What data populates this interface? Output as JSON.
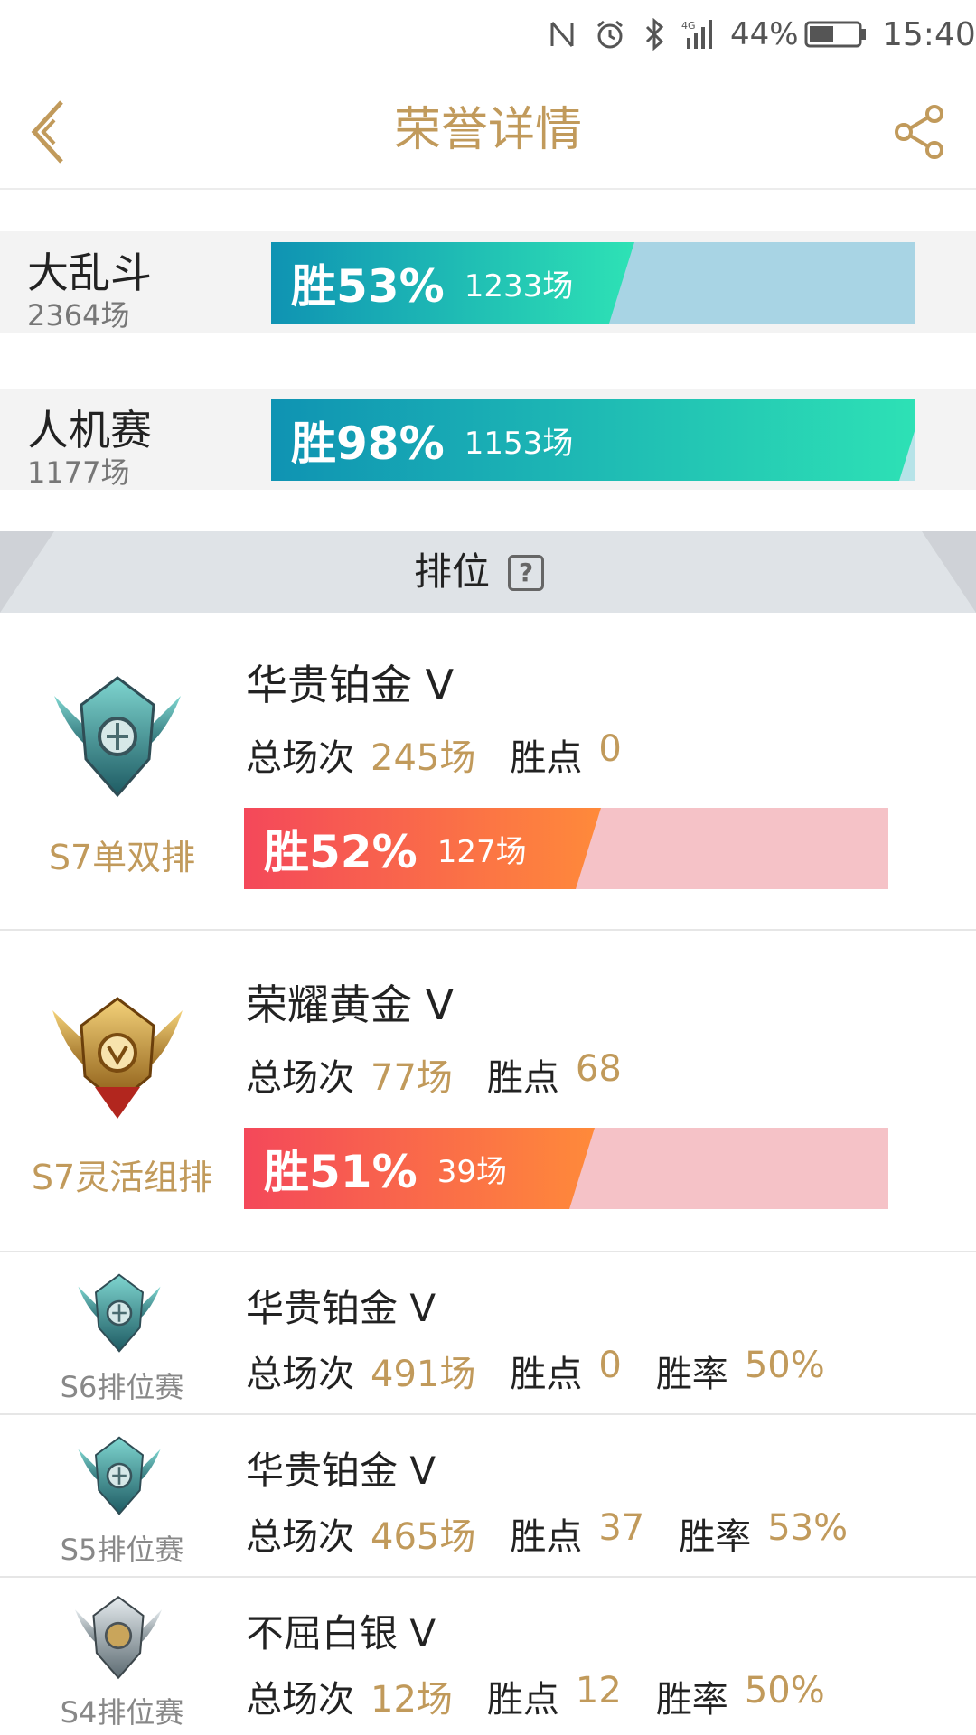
{
  "status_bar": {
    "battery_pct": "44%",
    "time": "15:40",
    "network": "4G",
    "icons": [
      "nfc-icon",
      "alarm-icon",
      "bluetooth-icon",
      "signal-icon",
      "battery-icon"
    ]
  },
  "header": {
    "title": "荣誉详情",
    "back_icon": "chevron-left-icon",
    "share_icon": "share-icon"
  },
  "modes": [
    {
      "name": "大乱斗",
      "count": "2364场",
      "win_label": "胜53%",
      "win_fraction": 0.53,
      "win_games": "1233场"
    },
    {
      "name": "人机赛",
      "count": "1177场",
      "win_label": "胜98%",
      "win_fraction": 0.98,
      "win_games": "1153场"
    }
  ],
  "ranked": {
    "title": "排位",
    "help_label": "?"
  },
  "seasons": [
    {
      "label": "S7单双排",
      "tier": "华贵铂金 V",
      "total_label": "总场次",
      "total": "245场",
      "points_label": "胜点",
      "points": "0",
      "win_label": "胜52%",
      "win_fraction": 0.52,
      "win_games": "127场",
      "badge": "platinum"
    },
    {
      "label": "S7灵活组排",
      "tier": "荣耀黄金 V",
      "total_label": "总场次",
      "total": "77场",
      "points_label": "胜点",
      "points": "68",
      "win_label": "胜51%",
      "win_fraction": 0.51,
      "win_games": "39场",
      "badge": "gold"
    },
    {
      "label": "S6排位赛",
      "tier": "华贵铂金 V",
      "total_label": "总场次",
      "total": "491场",
      "points_label": "胜点",
      "points": "0",
      "rate_label": "胜率",
      "rate": "50%",
      "badge": "platinum"
    },
    {
      "label": "S5排位赛",
      "tier": "华贵铂金 V",
      "total_label": "总场次",
      "total": "465场",
      "points_label": "胜点",
      "points": "37",
      "rate_label": "胜率",
      "rate": "53%",
      "badge": "platinum"
    },
    {
      "label": "S4排位赛",
      "tier": "不屈白银 V",
      "total_label": "总场次",
      "total": "12场",
      "points_label": "胜点",
      "points": "12",
      "rate_label": "胜率",
      "rate": "50%",
      "badge": "silver"
    }
  ],
  "colors": {
    "accent_gold": "#c19a5b",
    "blue_bar": "#0f93b3",
    "red_bar": "#f4485a"
  }
}
